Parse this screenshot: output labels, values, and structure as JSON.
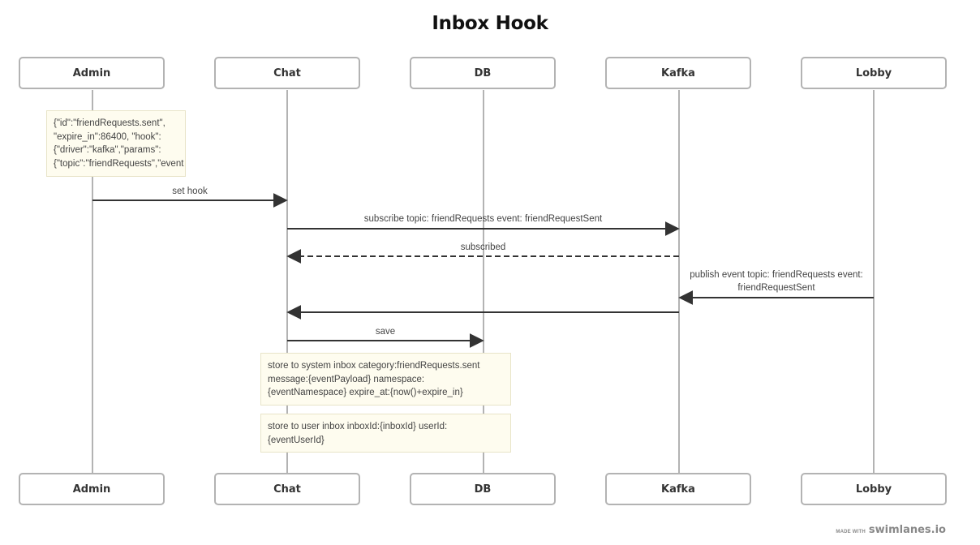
{
  "diagram": {
    "title": "Inbox Hook",
    "actors": [
      {
        "id": "admin",
        "label": "Admin"
      },
      {
        "id": "chat",
        "label": "Chat"
      },
      {
        "id": "db",
        "label": "DB"
      },
      {
        "id": "kafka",
        "label": "Kafka"
      },
      {
        "id": "lobby",
        "label": "Lobby"
      }
    ],
    "notes": [
      {
        "over": "admin",
        "lines": [
          "{\"id\":\"friendRequests.sent\",",
          "\"expire_in\":86400, \"hook\":",
          "{\"driver\":\"kafka\",\"params\":",
          "{\"topic\":\"friendRequests\",\"event"
        ]
      },
      {
        "over": "chat-db",
        "lines": [
          "store to system inbox category:friendRequests.sent",
          "message:{eventPayload} namespace:",
          "{eventNamespace} expire_at:{now()+expire_in}"
        ]
      },
      {
        "over": "chat-db",
        "lines": [
          "store to user inbox inboxId:{inboxId} userId:",
          "{eventUserId}"
        ]
      }
    ],
    "messages": [
      {
        "from": "admin",
        "to": "chat",
        "label": "set hook",
        "style": "solid"
      },
      {
        "from": "chat",
        "to": "kafka",
        "label": "subscribe topic: friendRequests event: friendRequestSent",
        "style": "solid"
      },
      {
        "from": "kafka",
        "to": "chat",
        "label": "subscribed",
        "style": "dashed"
      },
      {
        "from": "lobby",
        "to": "kafka",
        "label": "publish event topic: friendRequests event: friendRequestSent",
        "label_lines": [
          "publish event topic: friendRequests event:",
          "friendRequestSent"
        ],
        "style": "solid"
      },
      {
        "from": "kafka",
        "to": "chat",
        "label": "",
        "style": "solid"
      },
      {
        "from": "chat",
        "to": "db",
        "label": "save",
        "style": "solid"
      }
    ]
  },
  "footer": {
    "made_with": "MADE WITH",
    "brand": "swimlanes.io"
  },
  "colors": {
    "lifeline": "#b3b3b3",
    "arrow": "#333333",
    "note_bg": "#fefcef",
    "note_border": "#e8e4c8"
  }
}
